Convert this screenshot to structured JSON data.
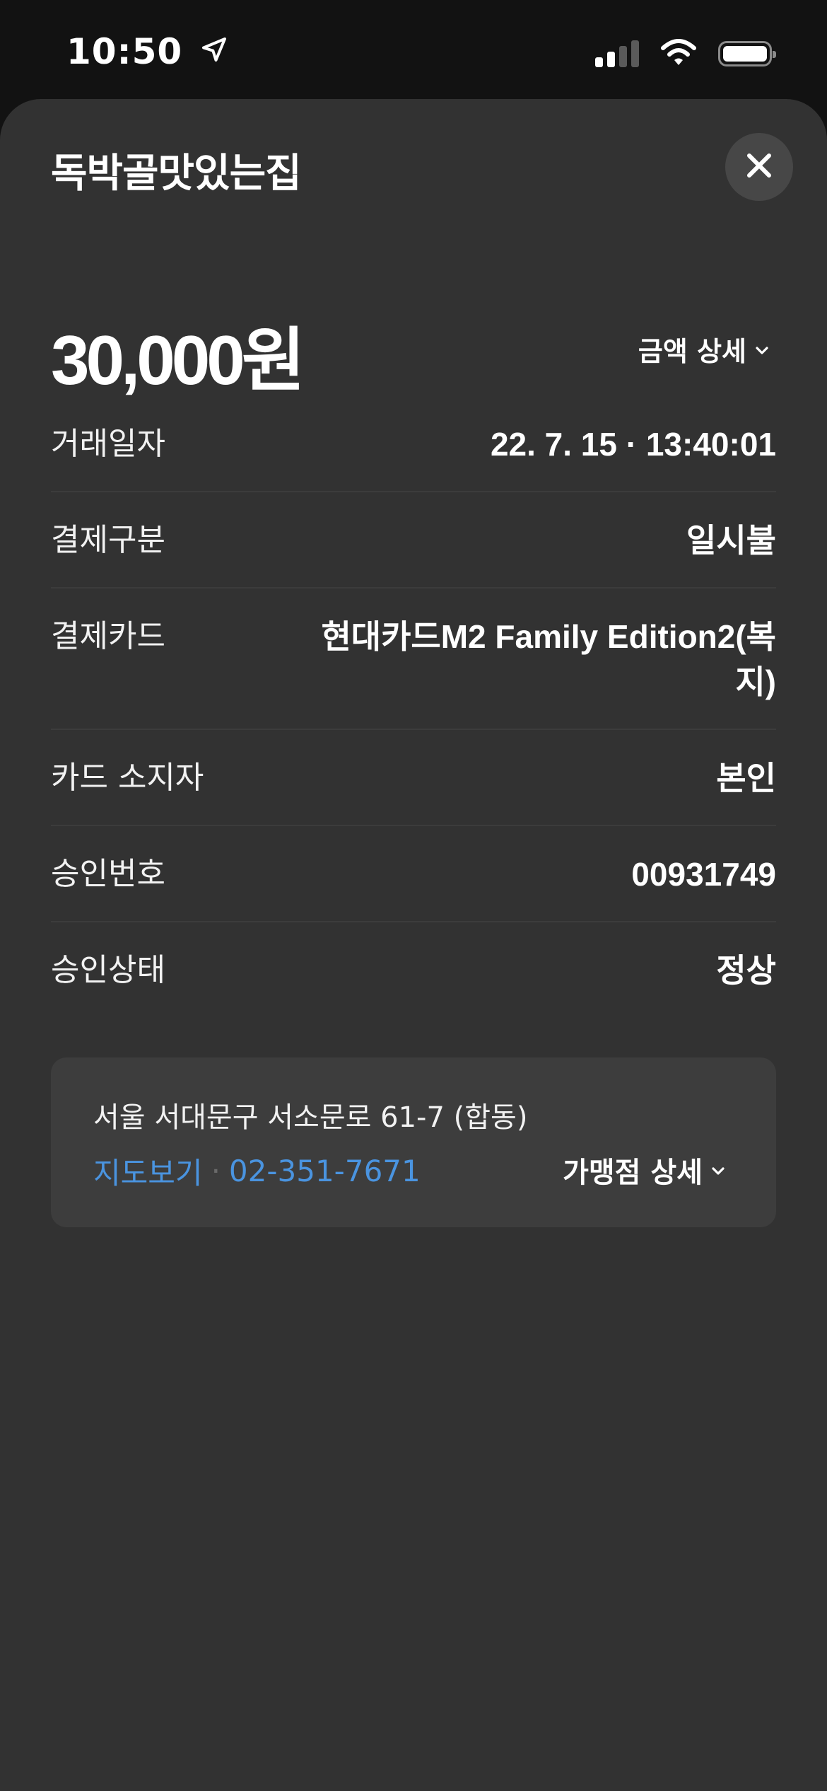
{
  "status_bar": {
    "time": "10:50"
  },
  "sheet": {
    "title": "독박골맛있는집",
    "amount": "30,000원",
    "amount_detail_label": "금액 상세",
    "rows": [
      {
        "label": "거래일자",
        "value": "22. 7. 15 · 13:40:01"
      },
      {
        "label": "결제구분",
        "value": "일시불"
      },
      {
        "label": "결제카드",
        "value": "현대카드M2 Family Edition2(복지)"
      },
      {
        "label": "카드 소지자",
        "value": "본인"
      },
      {
        "label": "승인번호",
        "value": "00931749"
      },
      {
        "label": "승인상태",
        "value": "정상"
      }
    ],
    "merchant": {
      "address": "서울 서대문구 서소문로 61-7 (합동)",
      "map_link": "지도보기",
      "separator": "·",
      "phone": "02-351-7671",
      "detail_label": "가맹점 상세"
    }
  },
  "colors": {
    "background": "#121212",
    "sheet": "#323232",
    "link": "#4a94e0"
  }
}
